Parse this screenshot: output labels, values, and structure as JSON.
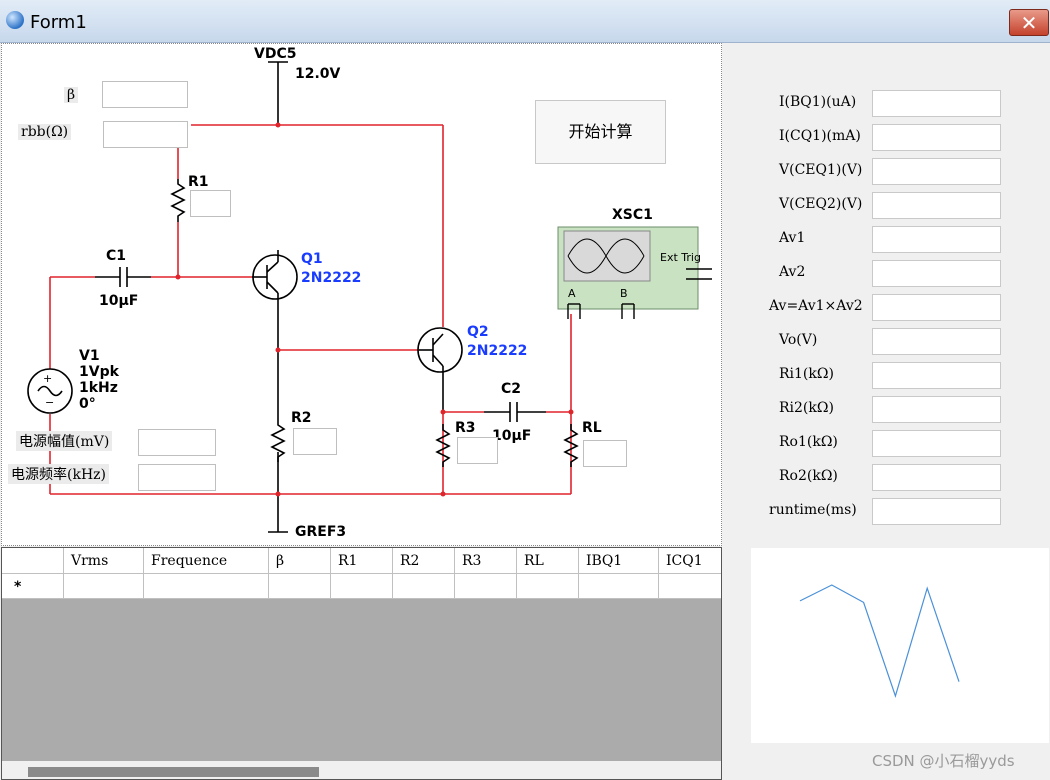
{
  "window": {
    "title": "Form1",
    "close_glyph": "✕"
  },
  "circuit": {
    "vdc_name": "VDC5",
    "vdc_value": "12.0V",
    "r1": "R1",
    "r2": "R2",
    "r3": "R3",
    "rl": "RL",
    "c1": "C1",
    "c1_value": "10µF",
    "c2": "C2",
    "c2_value": "10µF",
    "q1": "Q1",
    "q1_model": "2N2222",
    "q2": "Q2",
    "q2_model": "2N2222",
    "v1": "V1",
    "v1_amp": "1Vpk",
    "v1_freq": "1kHz",
    "v1_phase": "0°",
    "scope": "XSC1",
    "scope_trig": "Ext Trig",
    "scope_a": "A",
    "scope_b": "B",
    "gnd": "GREF3"
  },
  "inputs": {
    "beta_label": "β",
    "rbb_label": "rbb(Ω)",
    "amp_label": "电源幅值(mV)",
    "freq_label": "电源频率(kHz)",
    "r1": "",
    "r2": "",
    "r3": "",
    "rl": "",
    "beta": "",
    "rbb": "",
    "amp": "",
    "freq": ""
  },
  "calc_button": "开始计算",
  "results": [
    {
      "label": "I(BQ1)(uA)",
      "value": ""
    },
    {
      "label": "I(CQ1)(mA)",
      "value": ""
    },
    {
      "label": "V(CEQ1)(V)",
      "value": ""
    },
    {
      "label": "V(CEQ2)(V)",
      "value": ""
    },
    {
      "label": "Av1",
      "value": ""
    },
    {
      "label": "Av2",
      "value": ""
    },
    {
      "label": "Av=Av1×Av2",
      "value": ""
    },
    {
      "label": "Vo(V)",
      "value": ""
    },
    {
      "label": "Ri1(kΩ)",
      "value": ""
    },
    {
      "label": "Ri2(kΩ)",
      "value": ""
    },
    {
      "label": "Ro1(kΩ)",
      "value": ""
    },
    {
      "label": "Ro2(kΩ)",
      "value": ""
    },
    {
      "label": "runtime(ms)",
      "value": ""
    }
  ],
  "grid": {
    "columns": [
      "",
      "Vrms",
      "Frequence",
      "β",
      "R1",
      "R2",
      "R3",
      "RL",
      "IBQ1",
      "ICQ1"
    ],
    "new_row_marker": "*"
  },
  "chart_data": {
    "type": "line",
    "title": "",
    "x": [
      1,
      2,
      3,
      4,
      5,
      6
    ],
    "y": [
      3.0,
      4.0,
      2.9,
      -3.0,
      3.8,
      -2.1
    ],
    "xlim": [
      1,
      6
    ],
    "ylim": [
      -3,
      4
    ],
    "color": "#4a90d9"
  },
  "watermark": "CSDN @小石榴yyds"
}
